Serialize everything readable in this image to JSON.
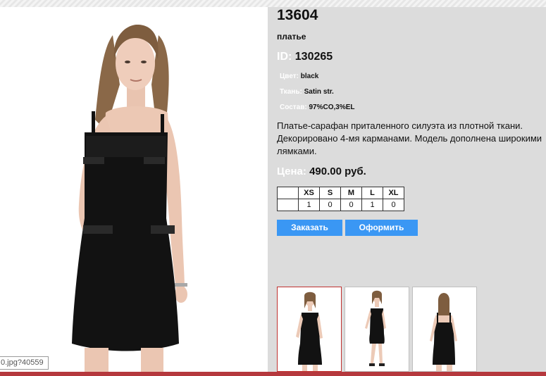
{
  "product": {
    "code": "13604",
    "type": "платье",
    "id_label": "ID:",
    "id_value": "130265",
    "color_label": "Цвет:",
    "color_value": "black",
    "fabric_label": "Ткань:",
    "fabric_value": "Satin str.",
    "composition_label": "Состав:",
    "composition_value": "97%CO,3%EL",
    "description": "Платье-сарафан приталенного силуэта из плотной ткани. Декорировано 4-мя карманами. Модель дополнена широкими лямками.",
    "price_label": "Цена:",
    "price_value": "490.00 руб."
  },
  "sizes": {
    "headers": [
      "",
      "XS",
      "S",
      "M",
      "L",
      "XL"
    ],
    "quantities": [
      "",
      "1",
      "0",
      "0",
      "1",
      "0"
    ]
  },
  "actions": {
    "order_label": "Заказать",
    "checkout_label": "Оформить"
  },
  "image_tooltip": "0.jpg?40559",
  "colors": {
    "panel_bg": "#dcdcdc",
    "button": "#3a97f4",
    "active_thumb_border": "#c0302e",
    "bottom_bar": "#b5383d"
  }
}
